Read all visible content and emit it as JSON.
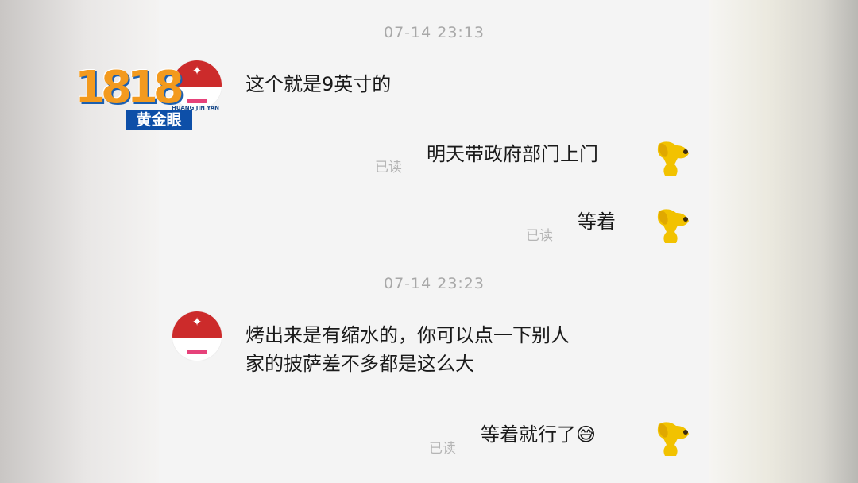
{
  "overlay": {
    "logo_number": "1818",
    "logo_name": "黄金眼",
    "logo_pinyin": "HUANG JIN YAN"
  },
  "chat": {
    "timestamps": [
      "07-14 23:13",
      "07-14 23:23"
    ],
    "read_label": "已读",
    "messages": [
      {
        "sender": "shop",
        "text": "这个就是9英寸的"
      },
      {
        "sender": "me",
        "text": "明天带政府部门上门"
      },
      {
        "sender": "me",
        "text": "等着"
      },
      {
        "sender": "shop",
        "line1": "烤出来是有缩水的，你可以点一下别人",
        "line2": "家的披萨差不多都是这么大"
      },
      {
        "sender": "me",
        "text": "等着就行了",
        "emoji": "😅"
      }
    ]
  },
  "avatars": {
    "shop_icon": "pizza-shop-logo-icon",
    "user_icon": "yellow-dog-icon"
  },
  "colors": {
    "chat_bg": "#f4f4f4",
    "shop_red": "#cc2b2b",
    "logo_orange": "#f39a1e",
    "logo_blue": "#0d4fa8",
    "dog_yellow": "#f2c200"
  }
}
